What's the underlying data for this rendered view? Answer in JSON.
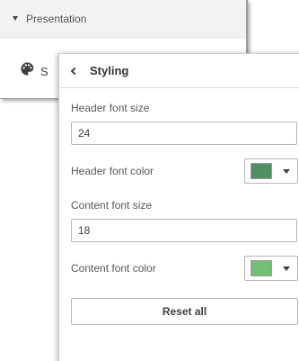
{
  "presentation_section": {
    "title": "Presentation",
    "item_label": "S",
    "item_icon": "palette-icon"
  },
  "styling_panel": {
    "title": "Styling",
    "back_icon": "chevron-left-icon",
    "header_font_size": {
      "label": "Header font size",
      "value": "24"
    },
    "header_font_color": {
      "label": "Header font color",
      "color": "#4e8f63"
    },
    "content_font_size": {
      "label": "Content font size",
      "value": "18"
    },
    "content_font_color": {
      "label": "Content font color",
      "color": "#70bf75"
    },
    "reset_label": "Reset all"
  }
}
